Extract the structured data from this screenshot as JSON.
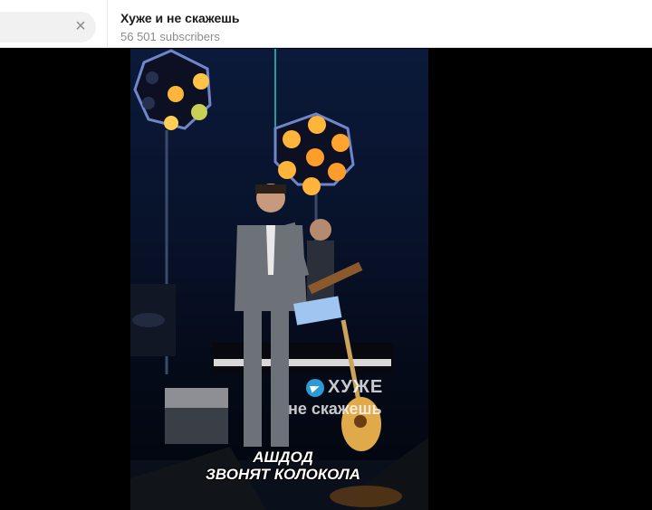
{
  "search": {
    "clear_icon": "×"
  },
  "channel": {
    "title": "Хуже и не скажешь",
    "subscribers": "56 501 subscribers"
  },
  "video": {
    "watermark_line1": "ХУЖЕ",
    "watermark_line2": "не скажешь",
    "caption_artist": "АШДОД",
    "caption_song": "ЗВОНЯТ КОЛОКОЛА"
  }
}
